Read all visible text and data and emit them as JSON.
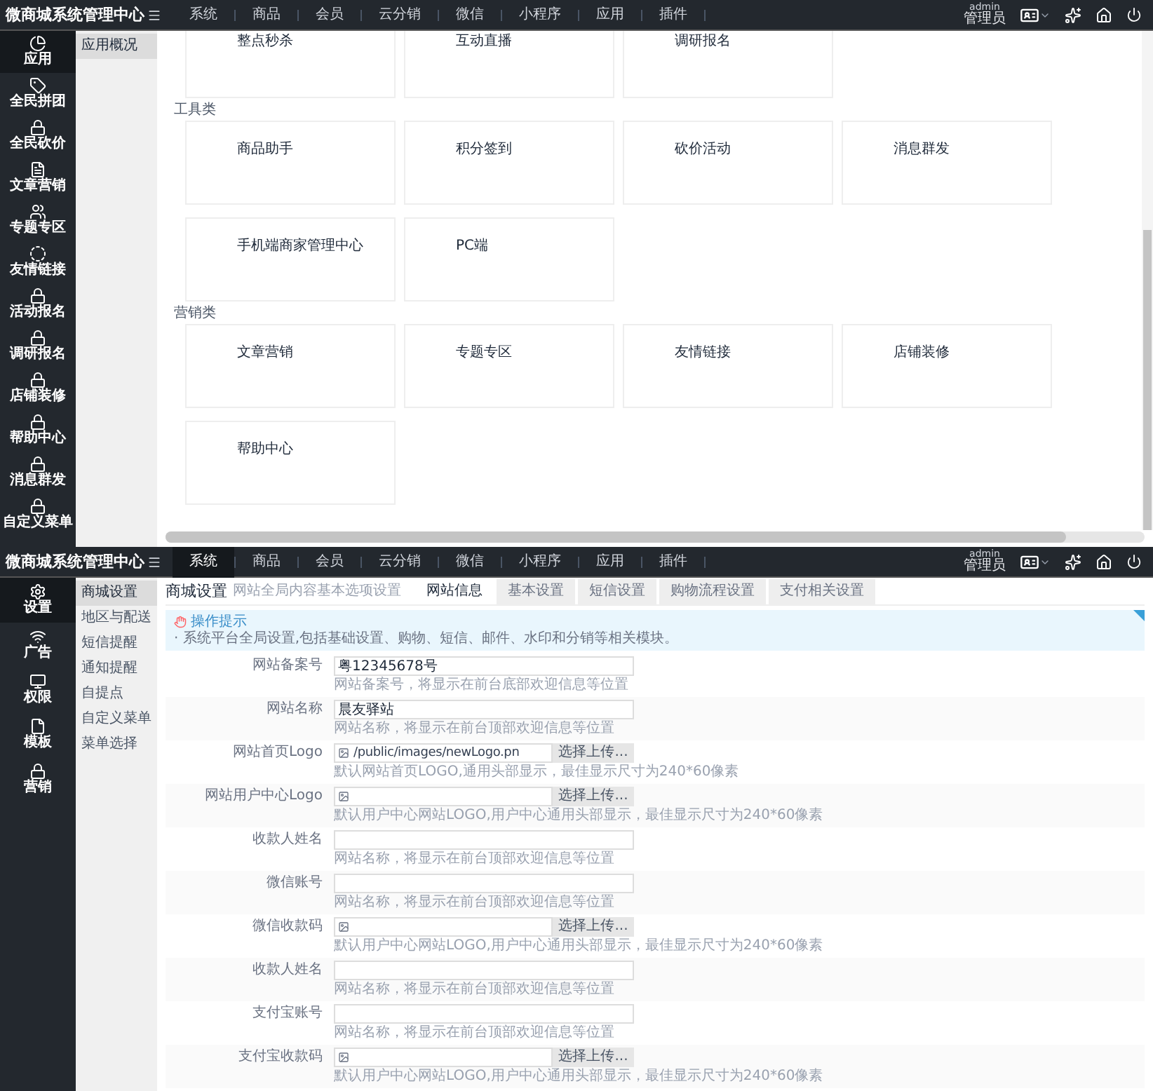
{
  "top_screen": {
    "header": {
      "title": "微商城系统管理中心",
      "nav": [
        {
          "label": "系统",
          "selected": false
        },
        {
          "label": "商品",
          "selected": false
        },
        {
          "label": "会员",
          "selected": false
        },
        {
          "label": "云分销",
          "selected": false
        },
        {
          "label": "微信",
          "selected": false
        },
        {
          "label": "小程序",
          "selected": false
        },
        {
          "label": "应用",
          "selected": false
        },
        {
          "label": "插件",
          "selected": false
        }
      ],
      "user": {
        "name": "admin",
        "role": "管理员"
      }
    },
    "sidebar": [
      {
        "label": "应用",
        "selected": true
      },
      {
        "label": "全民拼团",
        "selected": false
      },
      {
        "label": "全民砍价",
        "selected": false
      },
      {
        "label": "文章营销",
        "selected": false
      },
      {
        "label": "专题专区",
        "selected": false
      },
      {
        "label": "友情链接",
        "selected": false
      },
      {
        "label": "活动报名",
        "selected": false
      },
      {
        "label": "调研报名",
        "selected": false
      },
      {
        "label": "店铺装修",
        "selected": false
      },
      {
        "label": "帮助中心",
        "selected": false
      },
      {
        "label": "消息群发",
        "selected": false
      },
      {
        "label": "自定义菜单",
        "selected": false
      }
    ],
    "subnav": [
      {
        "label": "应用概况",
        "selected": true
      }
    ],
    "sections": [
      {
        "cards": [
          "整点秒杀",
          "互动直播",
          "调研报名"
        ]
      },
      {
        "heading": "工具类",
        "cards": [
          "商品助手",
          "积分签到",
          "砍价活动",
          "消息群发",
          "手机端商家管理中心",
          "PC端"
        ]
      },
      {
        "heading": "营销类",
        "cards": [
          "文章营销",
          "专题专区",
          "友情链接",
          "店铺装修",
          "帮助中心"
        ]
      }
    ]
  },
  "bottom_screen": {
    "header": {
      "title": "微商城系统管理中心",
      "nav": [
        {
          "label": "系统",
          "selected": true
        },
        {
          "label": "商品",
          "selected": false
        },
        {
          "label": "会员",
          "selected": false
        },
        {
          "label": "云分销",
          "selected": false
        },
        {
          "label": "微信",
          "selected": false
        },
        {
          "label": "小程序",
          "selected": false
        },
        {
          "label": "应用",
          "selected": false
        },
        {
          "label": "插件",
          "selected": false
        }
      ],
      "user": {
        "name": "admin",
        "role": "管理员"
      }
    },
    "sidebar": [
      {
        "label": "设置",
        "selected": true
      },
      {
        "label": "广告",
        "selected": false
      },
      {
        "label": "权限",
        "selected": false
      },
      {
        "label": "模板",
        "selected": false
      },
      {
        "label": "营销",
        "selected": false
      }
    ],
    "subnav": [
      {
        "label": "商城设置",
        "selected": true
      },
      {
        "label": "地区与配送",
        "selected": false
      },
      {
        "label": "短信提醒",
        "selected": false
      },
      {
        "label": "通知提醒",
        "selected": false
      },
      {
        "label": "自提点",
        "selected": false
      },
      {
        "label": "自定义菜单",
        "selected": false
      },
      {
        "label": "菜单选择",
        "selected": false
      }
    ],
    "page_title": "商城设置",
    "page_subtitle": "网站全局内容基本选项设置",
    "tabs": [
      {
        "label": "网站信息",
        "selected": true
      },
      {
        "label": "基本设置",
        "selected": false
      },
      {
        "label": "短信设置",
        "selected": false
      },
      {
        "label": "购物流程设置",
        "selected": false
      },
      {
        "label": "支付相关设置",
        "selected": false
      }
    ],
    "tip": {
      "title": "操作提示",
      "text": "· 系统平台全局设置,包括基础设置、购物、短信、邮件、水印和分销等相关模块。"
    },
    "form": [
      {
        "label": "网站备案号",
        "kind": "text",
        "value": "粤12345678号",
        "hint": "网站备案号，将显示在前台底部欢迎信息等位置"
      },
      {
        "label": "网站名称",
        "kind": "text",
        "value": "晨友驿站",
        "hint": "网站名称，将显示在前台顶部欢迎信息等位置"
      },
      {
        "label": "网站首页Logo",
        "kind": "file",
        "value": "/public/images/newLogo.pn",
        "button": "选择上传...",
        "hint": "默认网站首页LOGO,通用头部显示，最佳显示尺寸为240*60像素"
      },
      {
        "label": "网站用户中心Logo",
        "kind": "file",
        "button": "选择上传...",
        "hint": "默认用户中心网站LOGO,用户中心通用头部显示，最佳显示尺寸为240*60像素"
      },
      {
        "label": "收款人姓名",
        "kind": "text",
        "hint": "网站名称，将显示在前台顶部欢迎信息等位置"
      },
      {
        "label": "微信账号",
        "kind": "text",
        "hint": "网站名称，将显示在前台顶部欢迎信息等位置"
      },
      {
        "label": "微信收款码",
        "kind": "file",
        "button": "选择上传...",
        "hint": "默认用户中心网站LOGO,用户中心通用头部显示，最佳显示尺寸为240*60像素"
      },
      {
        "label": "收款人姓名",
        "kind": "text",
        "hint": "网站名称，将显示在前台顶部欢迎信息等位置"
      },
      {
        "label": "支付宝账号",
        "kind": "text",
        "hint": "网站名称，将显示在前台顶部欢迎信息等位置"
      },
      {
        "label": "支付宝收款码",
        "kind": "file",
        "button": "选择上传...",
        "hint": "默认用户中心网站LOGO,用户中心通用头部显示，最佳显示尺寸为240*60像素"
      }
    ]
  }
}
